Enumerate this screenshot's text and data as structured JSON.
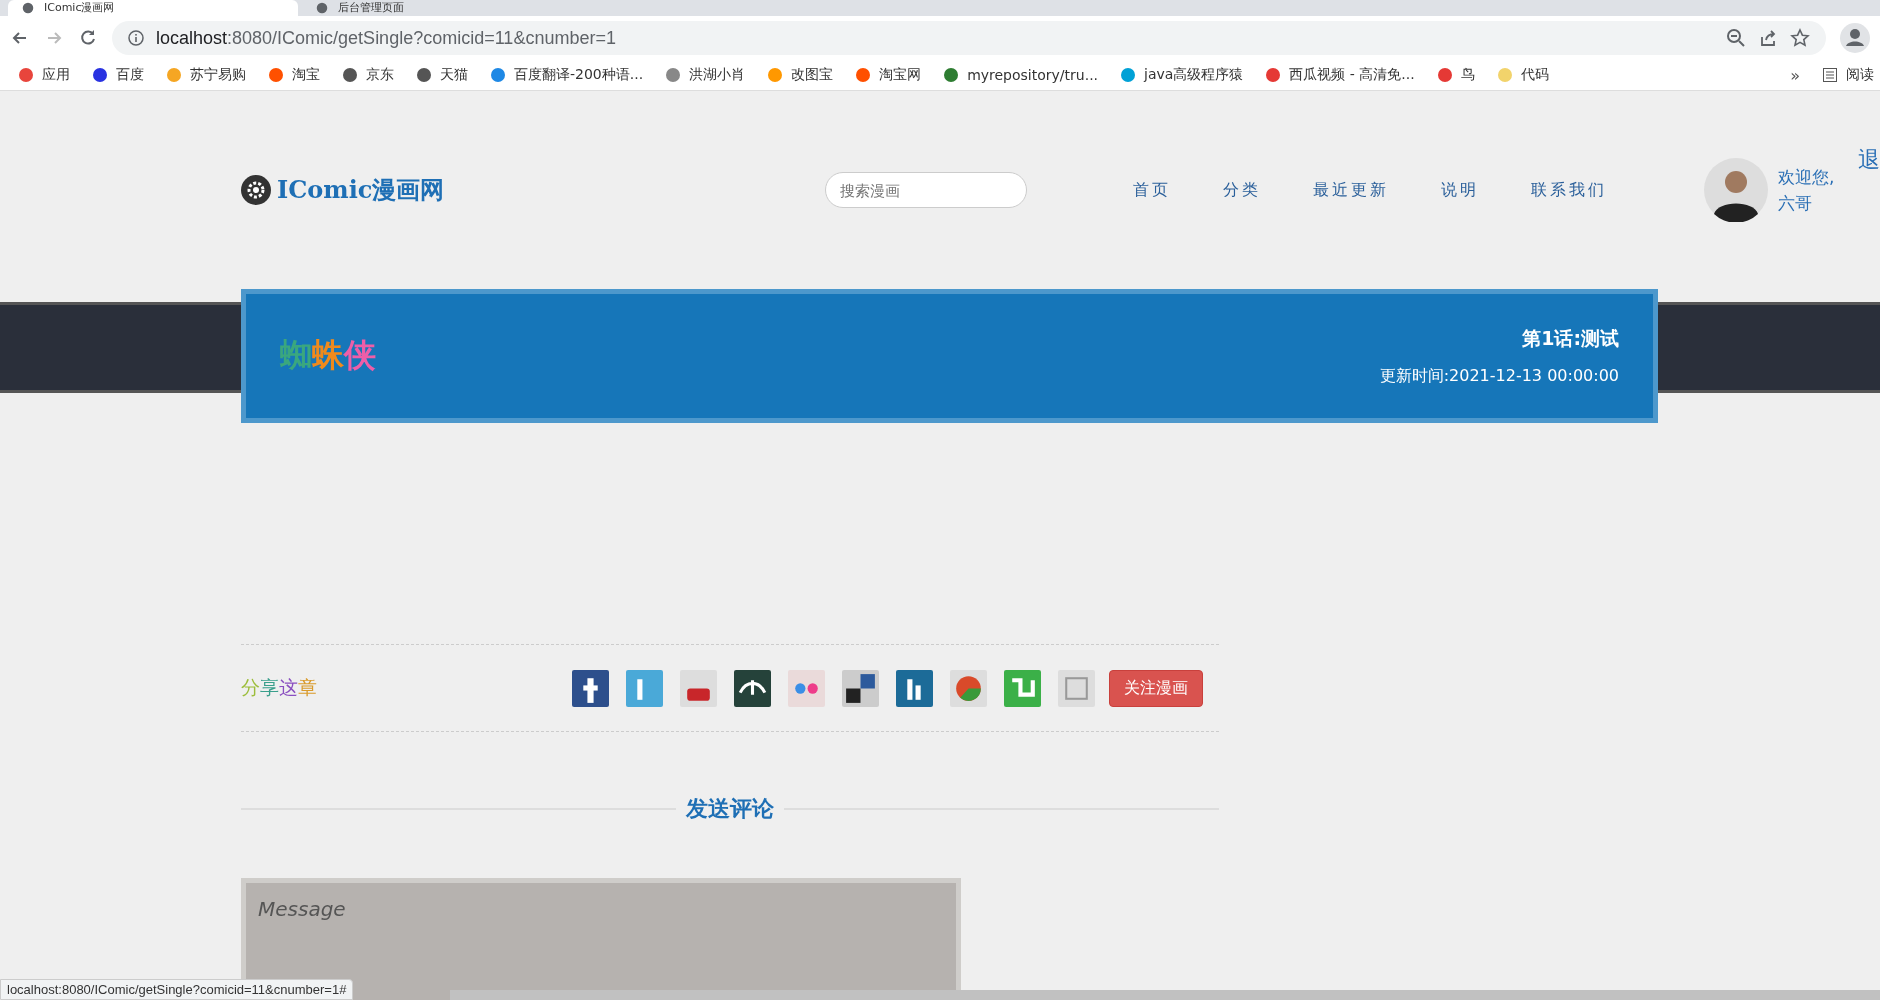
{
  "browser": {
    "tabs": [
      {
        "title": "IComic漫画网",
        "selected": true
      },
      {
        "title": "后台管理页面",
        "selected": false
      }
    ],
    "url_host": "localhost",
    "url_rest": ":8080/IComic/getSingle?comicid=11&cnumber=1",
    "bookmarks": [
      "应用",
      "百度",
      "苏宁易购",
      "淘宝",
      "京东",
      "天猫",
      "百度翻译-200种语...",
      "洪湖小肖",
      "改图宝",
      "淘宝网",
      "myrepository/tru...",
      "java高级程序猿",
      "西瓜视频 - 高清免...",
      "鸟",
      "代码"
    ],
    "more": "»",
    "reading_list": "阅读"
  },
  "header": {
    "logo": "IComic漫画网",
    "search": {
      "placeholder": "搜索漫画"
    },
    "nav": [
      "首页",
      "分类",
      "最近更新",
      "说明",
      "联系我们"
    ],
    "welcome": "欢迎您,",
    "user": "六哥",
    "logout": "退"
  },
  "banner": {
    "title_chars": [
      {
        "text": "蜘",
        "color": "#3aa77e"
      },
      {
        "text": "蛛",
        "color": "#f08a1c"
      },
      {
        "text": "侠",
        "color": "#ee5ea8"
      }
    ],
    "chapter": "第1话:测试",
    "updated": "更新时间:2021-12-13 00:00:00"
  },
  "share": {
    "label_chars": [
      {
        "text": "分",
        "color": "#9cbd3a"
      },
      {
        "text": "享",
        "color": "#3a9f8c"
      },
      {
        "text": "这",
        "color": "#8a4fc0"
      },
      {
        "text": "章",
        "color": "#d99a2b"
      }
    ],
    "follow": "关注漫画"
  },
  "comment": {
    "heading": "发送评论",
    "placeholder": "Message"
  },
  "status": "localhost:8080/IComic/getSingle?comicid=11&cnumber=1#"
}
